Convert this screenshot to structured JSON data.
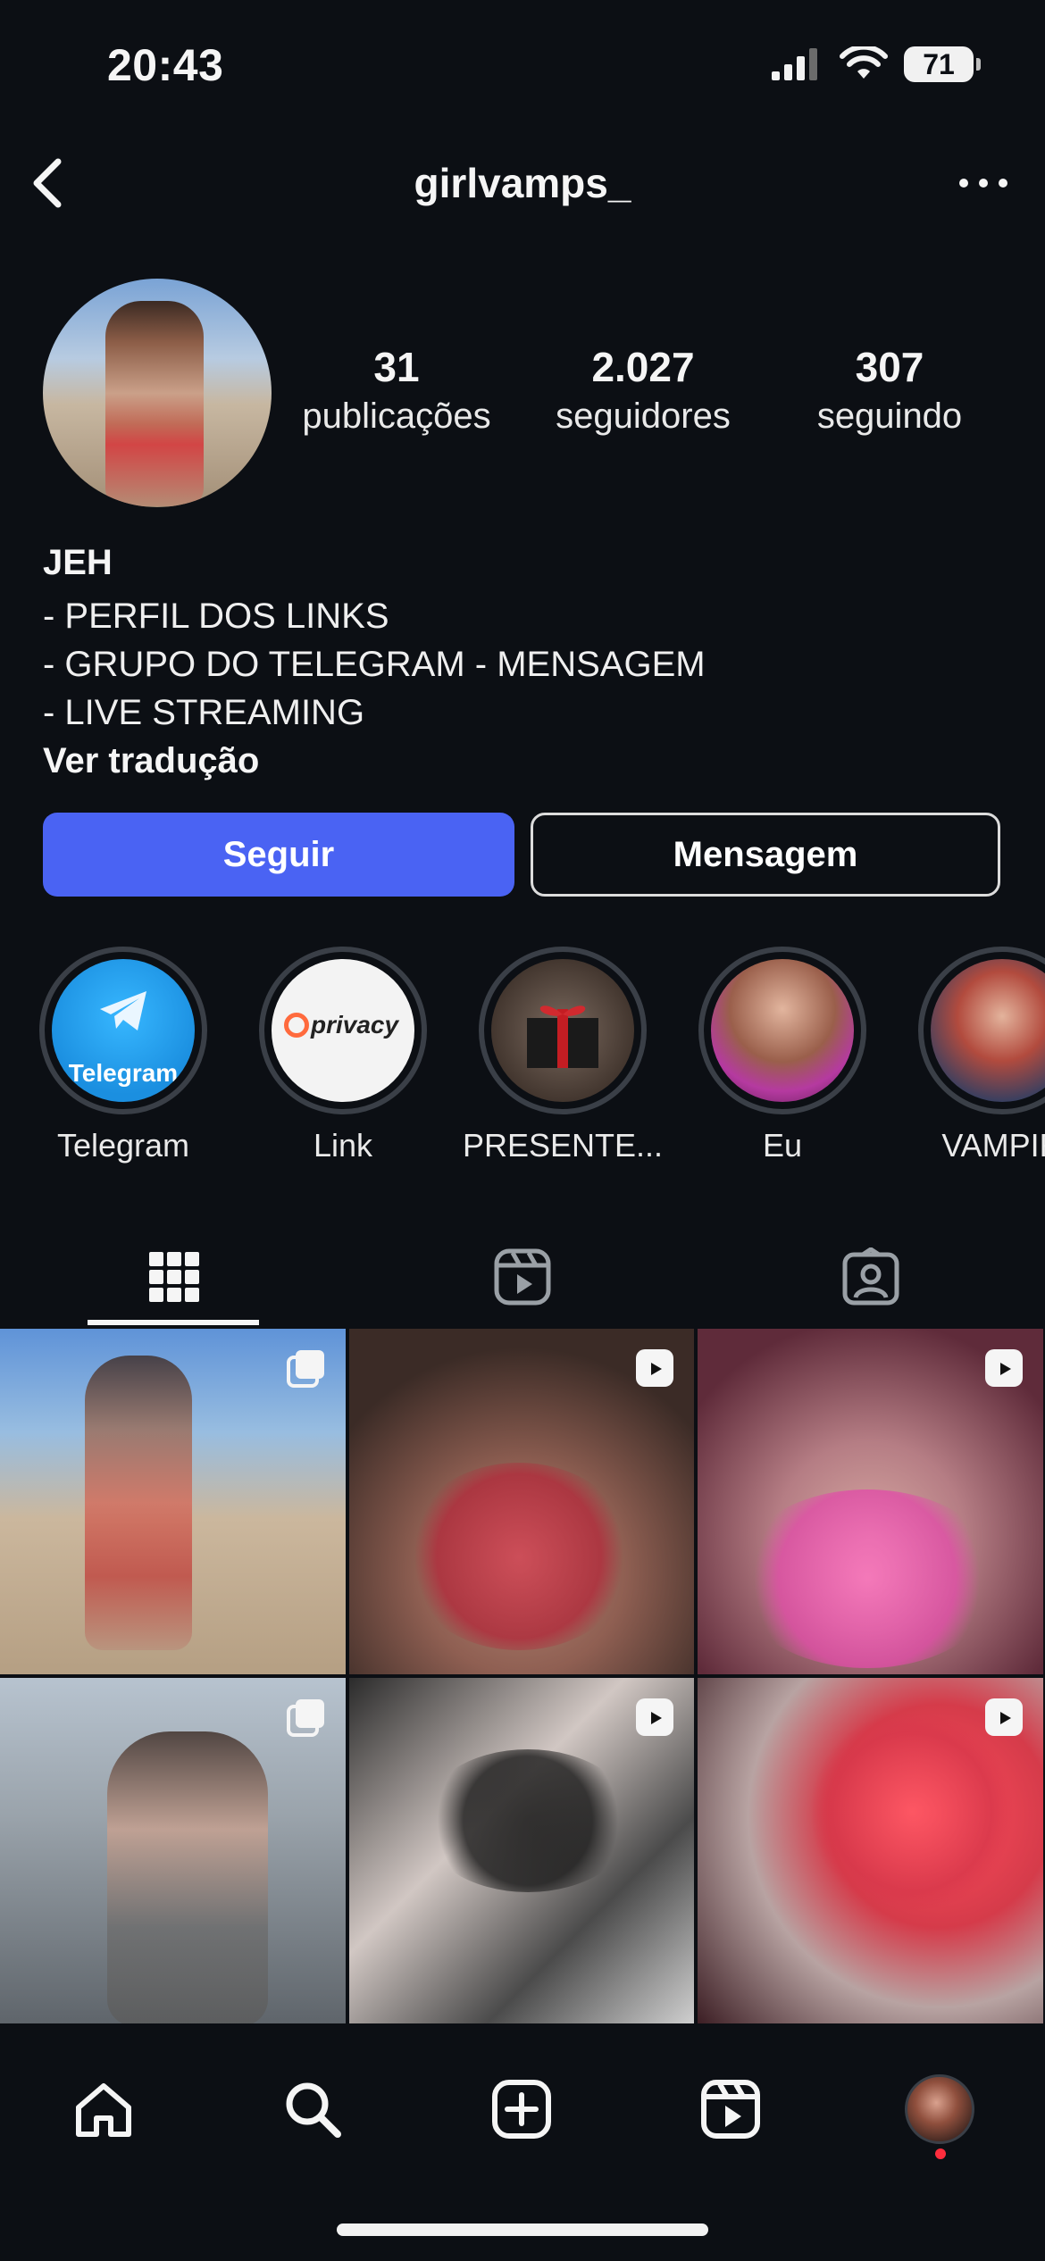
{
  "status_bar": {
    "time": "20:43",
    "battery": "71"
  },
  "header": {
    "username": "girlvamps_"
  },
  "profile": {
    "stats": [
      {
        "count": "31",
        "label": "publicações"
      },
      {
        "count": "2.027",
        "label": "seguidores"
      },
      {
        "count": "307",
        "label": "seguindo"
      }
    ],
    "name": "JEH",
    "bio_lines": [
      "- PERFIL DOS LINKS",
      "- GRUPO DO TELEGRAM - MENSAGEM",
      "- LIVE STREAMING"
    ],
    "see_translation": "Ver tradução",
    "follow_label": "Seguir",
    "message_label": "Mensagem"
  },
  "highlights": [
    {
      "title": "Telegram",
      "badge_text": "Telegram"
    },
    {
      "title": "Link",
      "badge_text": "privacy"
    },
    {
      "title": "PRESENTE..."
    },
    {
      "title": "Eu"
    },
    {
      "title": "VAMPIR"
    }
  ],
  "tabs": [
    {
      "icon": "grid-icon"
    },
    {
      "icon": "reels-icon"
    },
    {
      "icon": "tagged-icon"
    }
  ],
  "grid": [
    {
      "type": "carousel",
      "icon": "carousel-icon"
    },
    {
      "type": "reel",
      "icon": "reel-icon"
    },
    {
      "type": "reel",
      "icon": "reel-icon"
    },
    {
      "type": "carousel",
      "icon": "carousel-icon"
    },
    {
      "type": "reel",
      "icon": "reel-icon"
    },
    {
      "type": "reel",
      "icon": "reel-icon"
    }
  ],
  "bottom_nav": [
    {
      "icon": "home-icon"
    },
    {
      "icon": "search-icon"
    },
    {
      "icon": "create-icon"
    },
    {
      "icon": "reels-icon"
    },
    {
      "icon": "profile-avatar"
    }
  ],
  "colors": {
    "background": "#0c0f14",
    "follow_button": "#4a63f3",
    "notification_dot": "#ff2d3d"
  }
}
